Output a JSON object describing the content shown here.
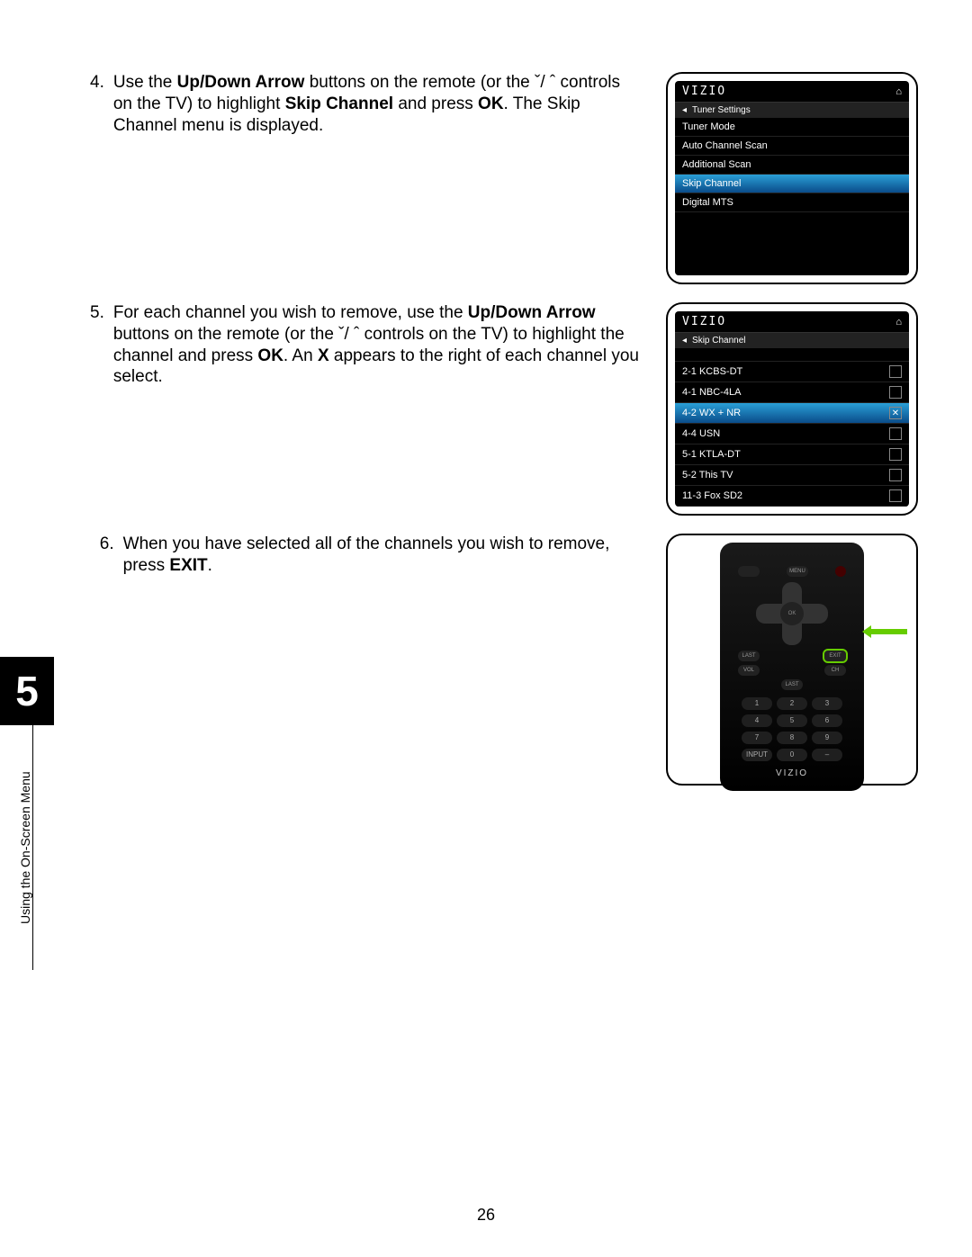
{
  "chapter": {
    "number": "5",
    "label": "Using the On-Screen Menu"
  },
  "page_number": "26",
  "steps": [
    {
      "n": "4.",
      "text": "Use the <b>Up/Down Arrow</b> buttons on the remote (or the ˇ/ ˆ controls on the TV) to highlight <b>Skip Channel</b> and press <b>OK</b>. The Skip Channel menu is displayed."
    },
    {
      "n": "5.",
      "text": "For each channel you wish to remove, use the <b>Up/Down Arrow</b> buttons on the remote (or the ˇ/ ˆ controls on the TV) to highlight the channel and press <b>OK</b>. An <b>X</b> appears to the right of each channel you select."
    },
    {
      "n": "6.",
      "text": "When you have selected all of the channels you wish to remove, press <b>EXIT</b>."
    }
  ],
  "fig1": {
    "brand": "VIZIO",
    "crumb": "Tuner Settings",
    "items": [
      {
        "label": "Tuner Mode"
      },
      {
        "label": "Auto Channel Scan"
      },
      {
        "label": "Additional Scan"
      },
      {
        "label": "Skip Channel",
        "sel": true
      },
      {
        "label": "Digital MTS"
      }
    ]
  },
  "fig2": {
    "brand": "VIZIO",
    "crumb": "Skip Channel",
    "items": [
      {
        "label": "2-1 KCBS-DT",
        "check": false
      },
      {
        "label": "4-1 NBC-4LA",
        "check": false
      },
      {
        "label": "4-2 WX + NR",
        "check": true,
        "sel": true
      },
      {
        "label": "4-4 USN",
        "check": false
      },
      {
        "label": "5-1 KTLA-DT",
        "check": false
      },
      {
        "label": "5-2 This TV",
        "check": false
      },
      {
        "label": "11-3 Fox SD2",
        "check": false
      }
    ]
  },
  "remote": {
    "brand": "VIZIO",
    "ok": "OK",
    "dpad": {
      "up": "ˆ",
      "down": "ˇ",
      "left": "‹",
      "right": "›"
    },
    "row1": [
      "",
      "MENU",
      ""
    ],
    "row2": [
      "LAST",
      "",
      "EXIT"
    ],
    "row3": [
      "VOL",
      "",
      "CH"
    ],
    "row4": [
      "",
      "LAST",
      ""
    ],
    "keys": [
      "1",
      "2",
      "3",
      "4",
      "5",
      "6",
      "7",
      "8",
      "9",
      "INPUT",
      "0",
      "–"
    ]
  }
}
